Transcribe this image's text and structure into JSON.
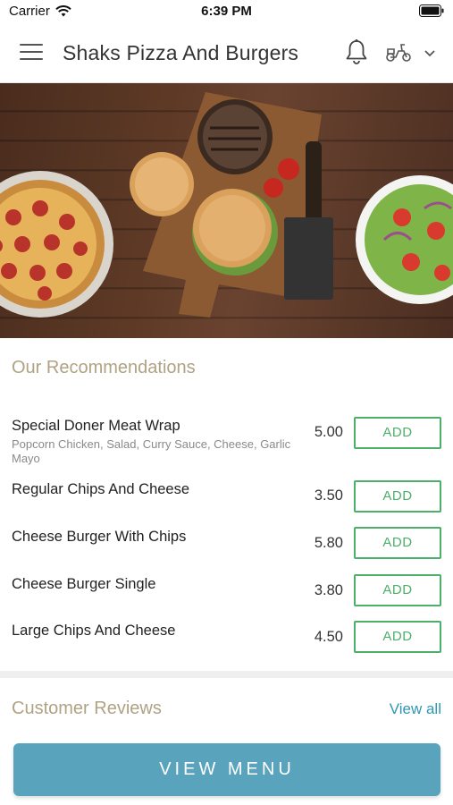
{
  "status_bar": {
    "carrier": "Carrier",
    "time": "6:39 PM"
  },
  "header": {
    "title": "Shaks Pizza And Burgers"
  },
  "recommendations": {
    "title": "Our Recommendations",
    "items": [
      {
        "name": "Special Doner Meat Wrap",
        "description": "Popcorn Chicken, Salad, Curry Sauce, Cheese, Garlic Mayo",
        "price": "5.00",
        "button": "ADD"
      },
      {
        "name": "Regular Chips And Cheese",
        "price": "3.50",
        "button": "ADD"
      },
      {
        "name": "Cheese Burger With Chips",
        "price": "5.80",
        "button": "ADD"
      },
      {
        "name": "Cheese Burger Single",
        "price": "3.80",
        "button": "ADD"
      },
      {
        "name": "Large Chips And Cheese",
        "price": "4.50",
        "button": "ADD"
      }
    ]
  },
  "reviews": {
    "title": "Customer Reviews",
    "view_all": "View all"
  },
  "footer": {
    "view_menu": "VIEW MENU"
  },
  "colors": {
    "accent_gold": "#b0a283",
    "add_green": "#4caf6a",
    "link_blue": "#2e97b5",
    "menu_button": "#5aa3bd"
  },
  "icons": [
    "wifi-icon",
    "battery-icon",
    "menu-icon",
    "bell-icon",
    "scooter-icon",
    "chevron-down-icon"
  ]
}
